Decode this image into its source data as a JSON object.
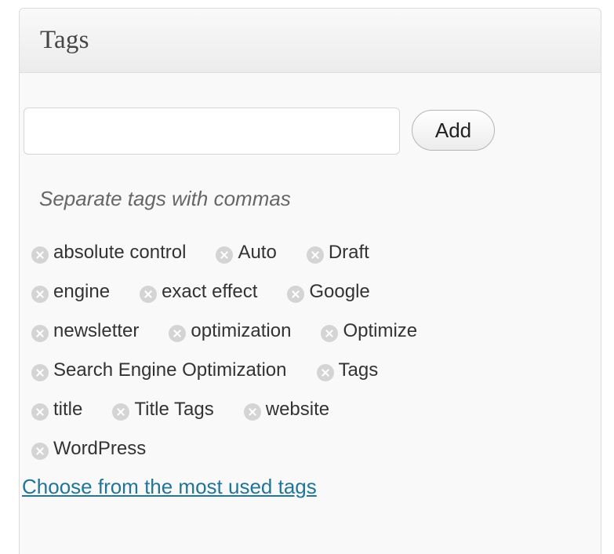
{
  "panel": {
    "title": "Tags"
  },
  "input": {
    "value": "",
    "placeholder": ""
  },
  "add_button": {
    "label": "Add"
  },
  "hint": "Separate tags with commas",
  "tags": [
    "absolute control",
    "Auto",
    "Draft",
    "engine",
    "exact effect",
    "Google",
    "newsletter",
    "optimization",
    "Optimize",
    "Search Engine Optimization",
    "Tags",
    "title",
    "Title Tags",
    "website",
    "WordPress"
  ],
  "most_used_link": "Choose from the most used tags",
  "colors": {
    "link": "#21759b",
    "remove_icon": "#d4d4d4",
    "panel_background": "#f9f9f9"
  },
  "icons": {
    "tag_remove": "remove-circle-x-icon"
  }
}
